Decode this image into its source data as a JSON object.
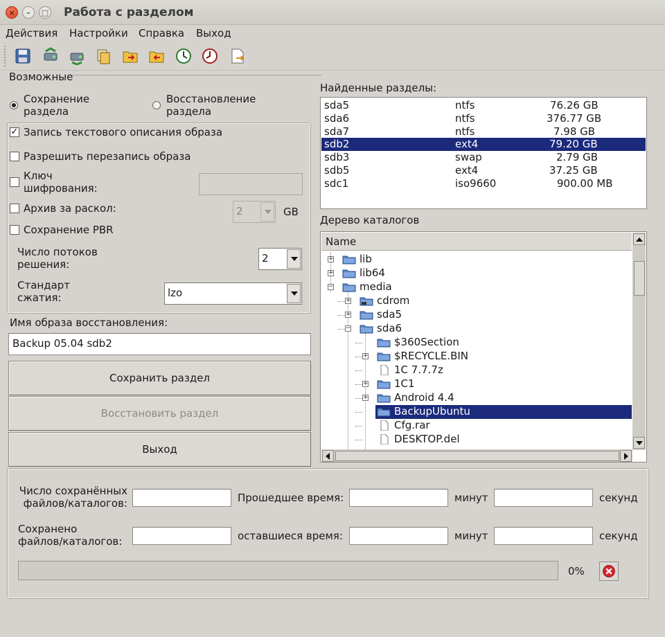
{
  "window": {
    "title": "Работа с разделом"
  },
  "menu": [
    "Действия",
    "Настройки",
    "Справка",
    "Выход"
  ],
  "toolbar": [
    {
      "icon": "save-disk-icon"
    },
    {
      "icon": "backup-partition-icon"
    },
    {
      "icon": "restore-partition-icon"
    },
    {
      "icon": "copy-icon"
    },
    {
      "icon": "folder-arrow-icon"
    },
    {
      "icon": "folder-export-icon"
    },
    {
      "icon": "clock-icon"
    },
    {
      "icon": "timer-icon"
    },
    {
      "icon": "document-export-icon"
    }
  ],
  "modes": {
    "group_label": "Возможные",
    "save": {
      "line1": "Сохранение",
      "line2": "раздела",
      "selected": true
    },
    "restore": {
      "line1": "Восстановление",
      "line2": "раздела",
      "selected": false
    }
  },
  "options": {
    "write_description": {
      "label": "Запись текстового описания образа",
      "checked": true
    },
    "allow_overwrite": {
      "label": "Разрешить перезапись образа",
      "checked": false
    },
    "encryption": {
      "label1": "Ключ",
      "label2": "шифрования:",
      "checked": false,
      "value": ""
    },
    "split_archive": {
      "label": "Архив за раскол:",
      "checked": false,
      "value": "2",
      "unit": "GB"
    },
    "save_pbr": {
      "label": "Сохранение PBR",
      "checked": false
    },
    "threads": {
      "label1": "Число потоков",
      "label2": "решения:",
      "value": "2"
    },
    "compression": {
      "label1": "Стандарт",
      "label2": "сжатия:",
      "value": "lzo"
    }
  },
  "image_name": {
    "label": "Имя образа восстановления:",
    "value": "Backup 05.04 sdb2"
  },
  "buttons": {
    "save": "Сохранить раздел",
    "restore": "Восстановить раздел",
    "exit": "Выход"
  },
  "partitions": {
    "label": "Найденные разделы:",
    "rows": [
      {
        "name": "sda5",
        "fs": "ntfs",
        "size": "76.26 GB"
      },
      {
        "name": "sda6",
        "fs": "ntfs",
        "size": "376.77 GB"
      },
      {
        "name": "sda7",
        "fs": "ntfs",
        "size": "7.98 GB"
      },
      {
        "name": "sdb2",
        "fs": "ext4",
        "size": "79.20 GB",
        "selected": true
      },
      {
        "name": "sdb3",
        "fs": "swap",
        "size": "2.79 GB"
      },
      {
        "name": "sdb5",
        "fs": "ext4",
        "size": "37.25 GB"
      },
      {
        "name": "sdc1",
        "fs": "iso9660",
        "size": "900.00 MB"
      }
    ]
  },
  "tree": {
    "label": "Дерево каталогов",
    "column": "Name",
    "items": [
      {
        "name": "lib",
        "expander": "+",
        "type": "folder"
      },
      {
        "name": "lib64",
        "expander": "+",
        "type": "folder"
      },
      {
        "name": "media",
        "expander": "-",
        "type": "folder"
      },
      {
        "name": "cdrom",
        "expander": "+",
        "type": "folder-drive"
      },
      {
        "name": "sda5",
        "expander": "+",
        "type": "folder"
      },
      {
        "name": "sda6",
        "expander": "-",
        "type": "folder"
      },
      {
        "name": "$360Section",
        "expander": "",
        "type": "folder"
      },
      {
        "name": "$RECYCLE.BIN",
        "expander": "+",
        "type": "folder"
      },
      {
        "name": "1C 7.7.7z",
        "expander": "",
        "type": "file"
      },
      {
        "name": "1C1",
        "expander": "+",
        "type": "folder"
      },
      {
        "name": "Android 4.4",
        "expander": "+",
        "type": "folder"
      },
      {
        "name": "BackupUbuntu",
        "expander": "",
        "type": "folder",
        "selected": true
      },
      {
        "name": "Cfg.rar",
        "expander": "",
        "type": "file"
      },
      {
        "name": "DESKTOP.del",
        "expander": "",
        "type": "file"
      }
    ]
  },
  "progress": {
    "saved_label1": "Число сохранённых",
    "saved_label2": "файлов/каталогов:",
    "elapsed_label": "Прошедшее время:",
    "minutes": "минут",
    "seconds": "секунд",
    "saved2_label1": "Сохранено",
    "saved2_label2": "файлов/каталогов:",
    "remaining_label": "оставшиеся время:",
    "percent": "0%",
    "fraction": 0
  }
}
